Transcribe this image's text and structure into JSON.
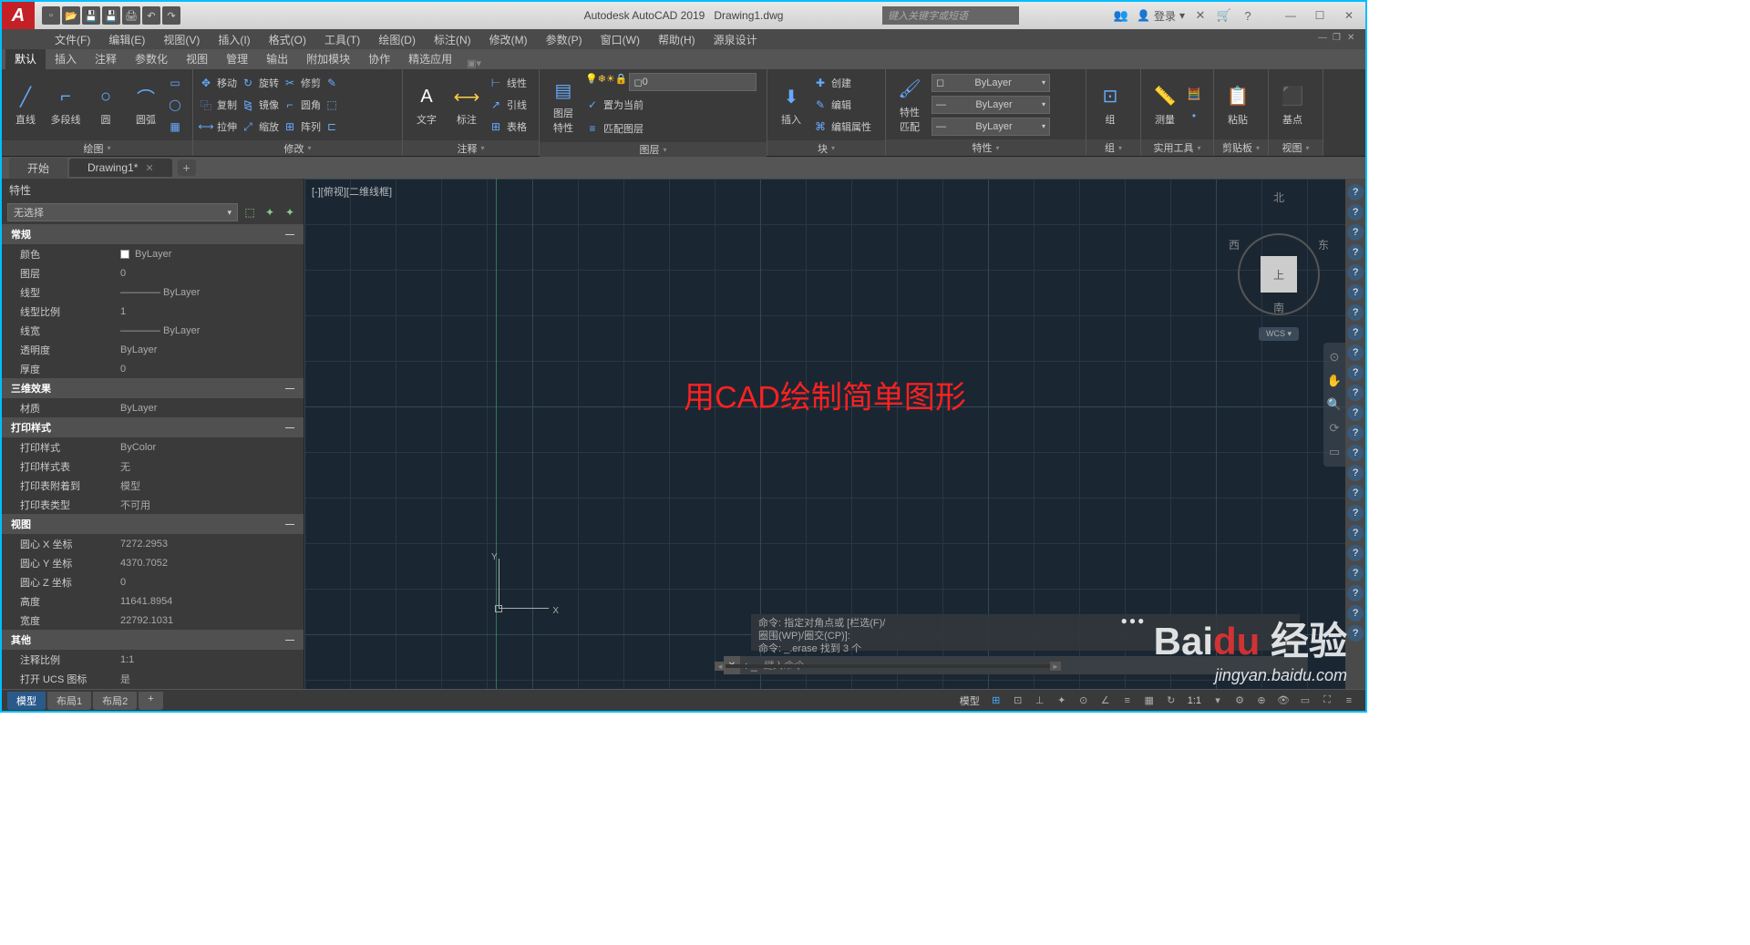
{
  "title": {
    "app": "Autodesk AutoCAD 2019",
    "file": "Drawing1.dwg"
  },
  "search_placeholder": "键入关键字或短语",
  "login": "登录",
  "menus": [
    "文件(F)",
    "编辑(E)",
    "视图(V)",
    "插入(I)",
    "格式(O)",
    "工具(T)",
    "绘图(D)",
    "标注(N)",
    "修改(M)",
    "参数(P)",
    "窗口(W)",
    "帮助(H)",
    "源泉设计"
  ],
  "ribbon_tabs": [
    "默认",
    "插入",
    "注释",
    "参数化",
    "视图",
    "管理",
    "输出",
    "附加模块",
    "协作",
    "精选应用"
  ],
  "ribbon": {
    "draw": {
      "label": "绘图",
      "items": [
        "直线",
        "多段线",
        "圆",
        "圆弧"
      ]
    },
    "modify": {
      "label": "修改",
      "move": "移动",
      "copy": "复制",
      "stretch": "拉伸",
      "rotate": "旋转",
      "mirror": "镜像",
      "scale": "缩放",
      "trim": "修剪",
      "fillet": "圆角",
      "array": "阵列"
    },
    "annot": {
      "label": "注释",
      "text": "文字",
      "dim": "标注",
      "linetype": "线性",
      "leader": "引线",
      "table": "表格"
    },
    "layer": {
      "label": "图层",
      "props": "图层\n特性",
      "current": "0",
      "set_current": "置为当前",
      "match": "匹配图层"
    },
    "block": {
      "label": "块",
      "insert": "插入",
      "create": "创建",
      "edit": "编辑",
      "edit_attr": "编辑属性"
    },
    "props": {
      "label": "特性",
      "match": "特性\n匹配",
      "bylayer": "ByLayer"
    },
    "group": {
      "label": "组",
      "item": "组"
    },
    "util": {
      "label": "实用工具",
      "measure": "测量"
    },
    "clip": {
      "label": "剪贴板",
      "paste": "粘贴"
    },
    "view": {
      "label": "视图",
      "base": "基点"
    }
  },
  "doc_tabs": {
    "start": "开始",
    "drawing": "Drawing1*"
  },
  "props_panel": {
    "title": "特性",
    "selector": "无选择",
    "sections": {
      "general": {
        "head": "常规",
        "rows": [
          {
            "k": "颜色",
            "v": "ByLayer",
            "swatch": true
          },
          {
            "k": "图层",
            "v": "0"
          },
          {
            "k": "线型",
            "v": "———— ByLayer"
          },
          {
            "k": "线型比例",
            "v": "1"
          },
          {
            "k": "线宽",
            "v": "———— ByLayer"
          },
          {
            "k": "透明度",
            "v": "ByLayer"
          },
          {
            "k": "厚度",
            "v": "0"
          }
        ]
      },
      "fx3d": {
        "head": "三维效果",
        "rows": [
          {
            "k": "材质",
            "v": "ByLayer"
          }
        ]
      },
      "plot": {
        "head": "打印样式",
        "rows": [
          {
            "k": "打印样式",
            "v": "ByColor"
          },
          {
            "k": "打印样式表",
            "v": "无"
          },
          {
            "k": "打印表附着到",
            "v": "模型"
          },
          {
            "k": "打印表类型",
            "v": "不可用"
          }
        ]
      },
      "view": {
        "head": "视图",
        "rows": [
          {
            "k": "圆心 X 坐标",
            "v": "7272.2953"
          },
          {
            "k": "圆心 Y 坐标",
            "v": "4370.7052"
          },
          {
            "k": "圆心 Z 坐标",
            "v": "0"
          },
          {
            "k": "高度",
            "v": "11641.8954"
          },
          {
            "k": "宽度",
            "v": "22792.1031"
          }
        ]
      },
      "misc": {
        "head": "其他",
        "rows": [
          {
            "k": "注释比例",
            "v": "1:1"
          },
          {
            "k": "打开 UCS 图标",
            "v": "是"
          }
        ]
      }
    }
  },
  "viewport_label": "[-][俯视][二维线框]",
  "viewcube": {
    "top": "上",
    "n": "北",
    "s": "南",
    "e": "东",
    "w": "西",
    "wcs": "WCS",
    "y": "Y",
    "x": "X"
  },
  "big_text": "用CAD绘制简单图形",
  "cmd": {
    "h1": "命令: 指定对角点或 [栏选(F)/",
    "h2": "圈围(WP)/圈交(CP)]:",
    "h3": "命令: _.erase 找到 3 个",
    "prompt": "▸_",
    "placeholder": "键入命令"
  },
  "layout_tabs": [
    "模型",
    "布局1",
    "布局2"
  ],
  "status": {
    "model": "模型",
    "ratio": "1:1"
  },
  "watermark": {
    "brand1": "Bai",
    "brand2": "du",
    "brand3": "经验",
    "url": "jingyan.baidu.com"
  }
}
